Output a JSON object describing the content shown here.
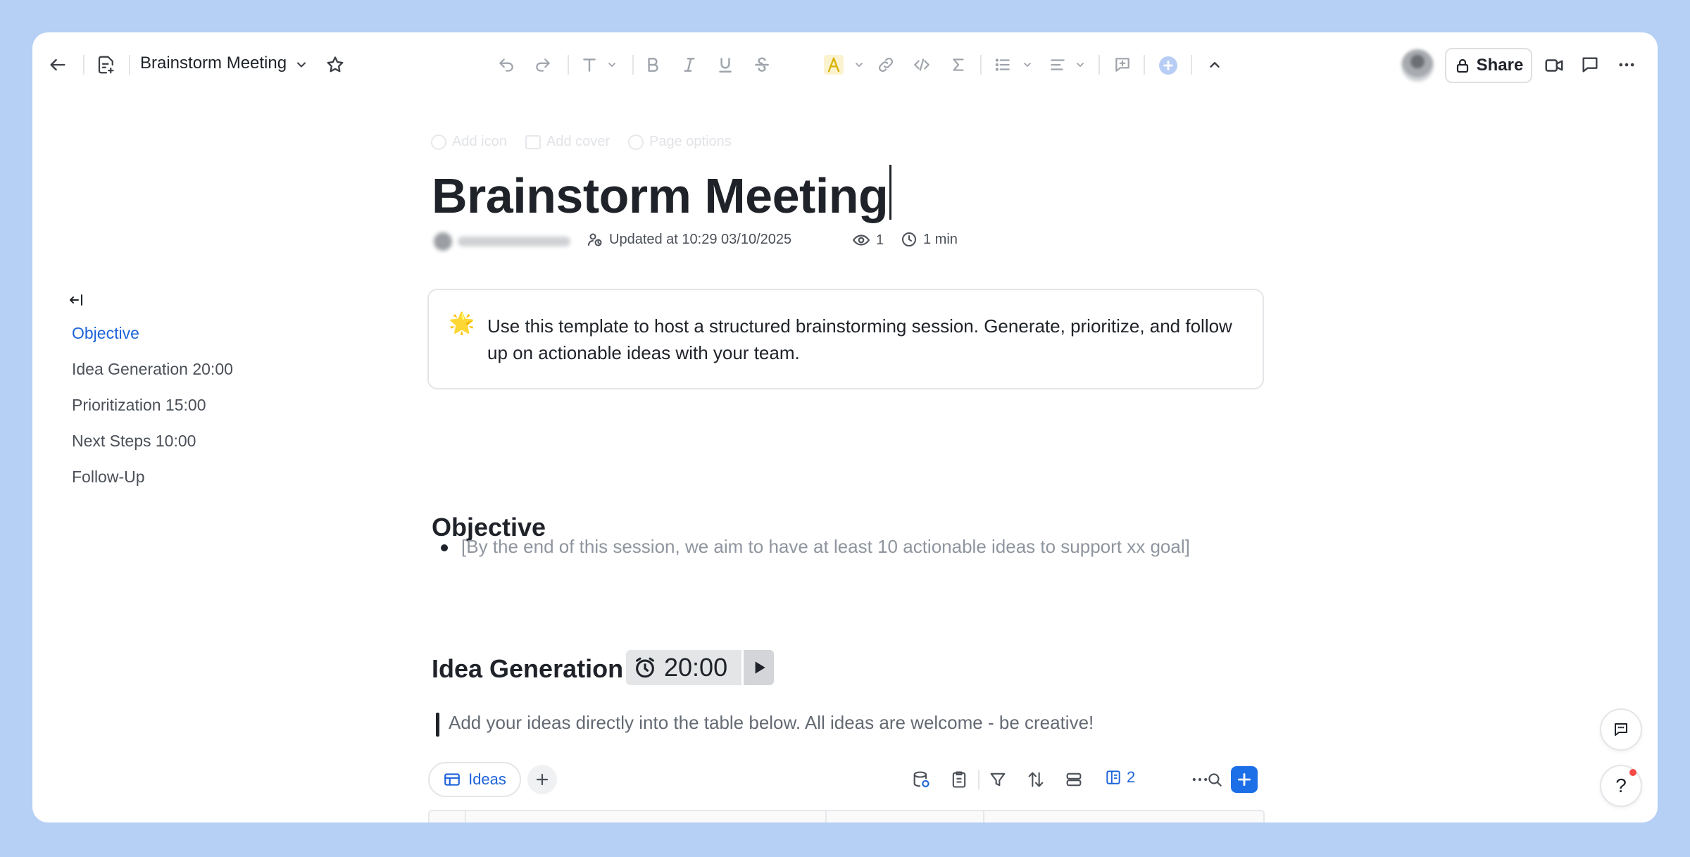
{
  "header": {
    "doc_title": "Brainstorm Meeting",
    "share_label": "Share"
  },
  "page_options": {
    "add_icon": "Add icon",
    "add_cover": "Add cover",
    "page_options": "Page options"
  },
  "document": {
    "title": "Brainstorm Meeting",
    "meta": {
      "updated": "Updated at 10:29 03/10/2025",
      "views": "1",
      "read_time": "1 min"
    },
    "callout": {
      "emoji": "🌟",
      "text": "Use this template to host a structured brainstorming session. Generate, prioritize, and follow up on actionable ideas with your team."
    },
    "objective": {
      "heading": "Objective",
      "bullet": "[By the end of this session, we aim to have at least 10 actionable ideas to support xx goal]"
    },
    "idea_generation": {
      "heading": "Idea Generation",
      "timer": "20:00",
      "quote": "Add your ideas directly into the table below. All ideas are welcome - be creative!"
    },
    "table": {
      "view_tab": "Ideas",
      "fields_count": "2"
    }
  },
  "outline": {
    "items": [
      {
        "label": "Objective",
        "active": true
      },
      {
        "label": "Idea Generation 20:00",
        "active": false
      },
      {
        "label": "Prioritization 15:00",
        "active": false
      },
      {
        "label": "Next Steps 10:00",
        "active": false
      },
      {
        "label": "Follow-Up",
        "active": false
      }
    ]
  },
  "colors": {
    "background": "#b5cff5",
    "accent": "#1d63d9",
    "primary_button": "#1d6fe8"
  },
  "icons": {
    "toolbar": [
      "undo-icon",
      "redo-icon",
      "text-style-icon",
      "bold-icon",
      "italic-icon",
      "underline-icon",
      "strikethrough-icon",
      "highlight-icon",
      "link-icon",
      "code-icon",
      "equation-icon",
      "bullet-list-icon",
      "align-icon",
      "comment-icon",
      "insert-icon",
      "collapse-toolbar-icon"
    ],
    "right": [
      "video-icon",
      "comment-icon",
      "more-icon"
    ]
  }
}
